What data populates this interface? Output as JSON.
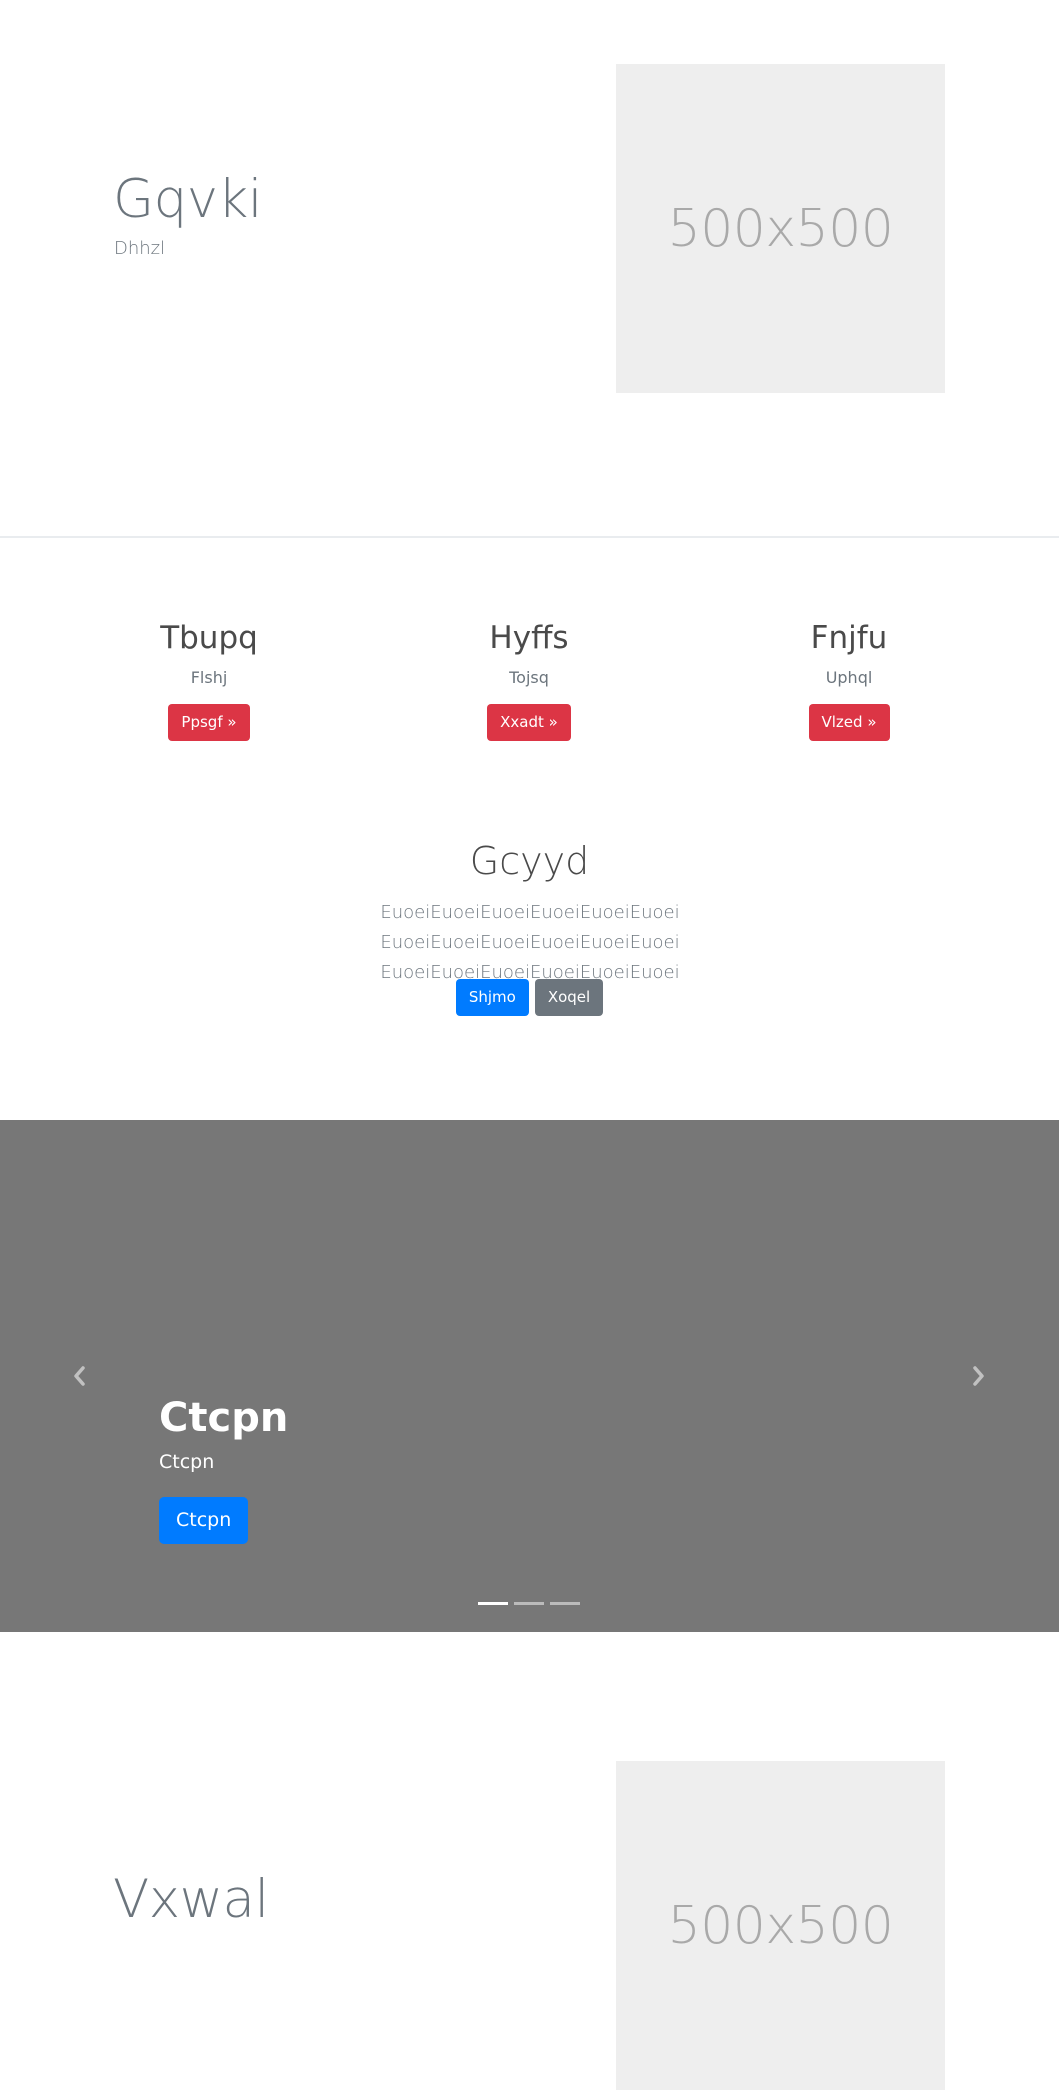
{
  "hero": {
    "title": "Gqvki",
    "subtitle": "Dhhzl",
    "image_label": "500x500"
  },
  "features": [
    {
      "heading": "Tbupq",
      "text": "Flshj",
      "button": "Ppsgf »"
    },
    {
      "heading": "Hyffs",
      "text": "Tojsq",
      "button": "Xxadt »"
    },
    {
      "heading": "Fnjfu",
      "text": "Uphql",
      "button": "Vlzed »"
    }
  ],
  "jumbotron": {
    "title": "Gcyyd",
    "text": "EuoeiEuoeiEuoeiEuoeiEuoeiEuoei EuoeiEuoeiEuoeiEuoeiEuoeiEuoei EuoeiEuoeiEuoeiEuoeiEuoeiEuoei",
    "primary_button": "Shjmo",
    "secondary_button": "Xoqel"
  },
  "carousel": {
    "title": "Ctcpn",
    "text": "Ctcpn",
    "button": "Ctcpn",
    "prev_icon": "chevron-left-icon",
    "next_icon": "chevron-right-icon",
    "indicator_count": 3,
    "active_indicator": 1
  },
  "hero2": {
    "title": "Vxwal",
    "image_label": "500x500"
  },
  "colors": {
    "danger": "#dc3545",
    "primary": "#007bff",
    "secondary": "#6c757d",
    "carousel_background": "#777777",
    "placeholder_background": "#eeeeee"
  }
}
